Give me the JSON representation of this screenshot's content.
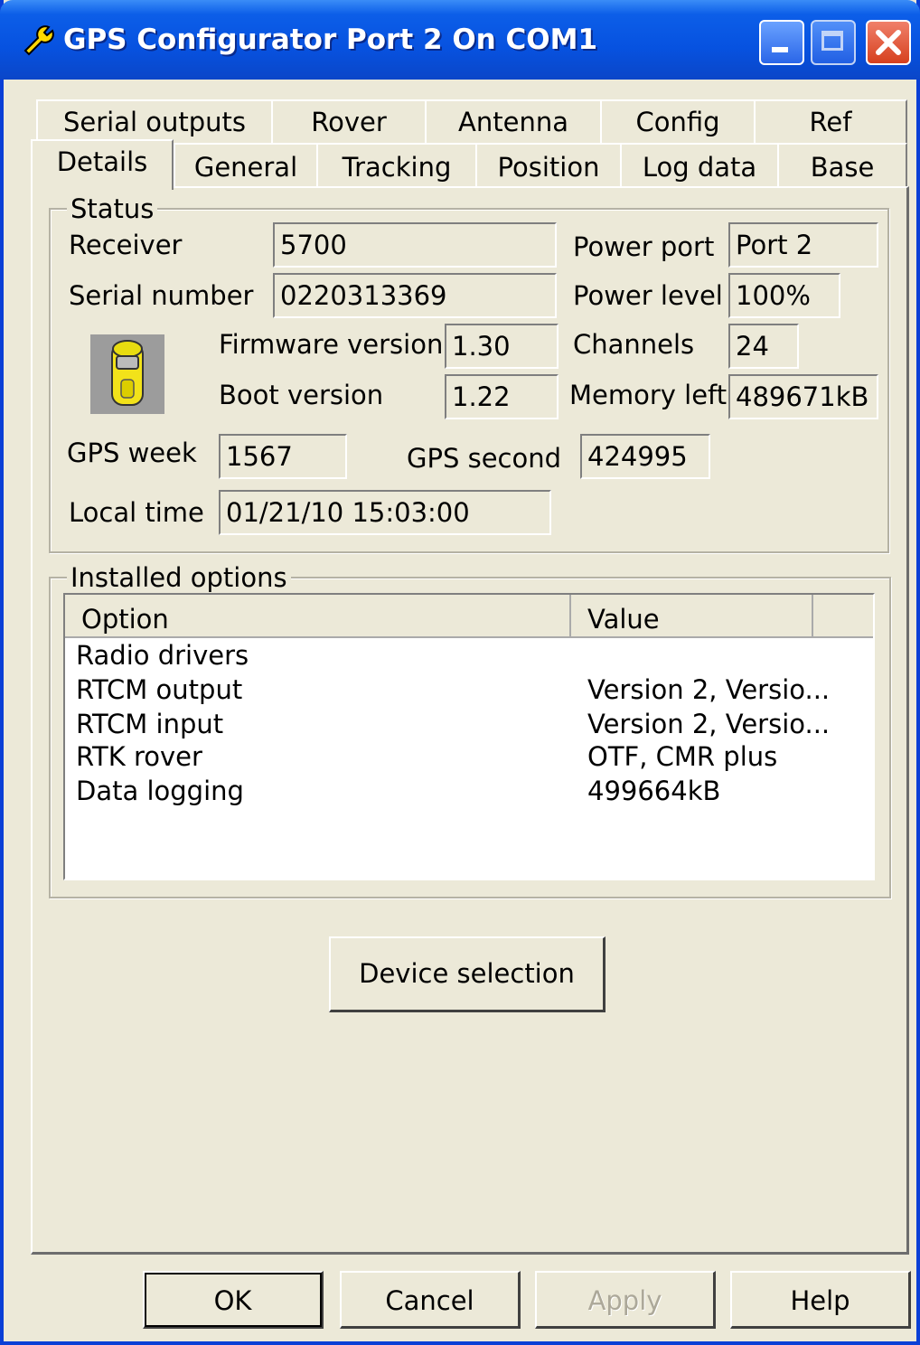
{
  "window": {
    "title": "GPS Configurator Port 2 On COM1",
    "controls": {
      "minimize": "minimize-icon",
      "maximize": "maximize-icon",
      "close": "close-icon"
    }
  },
  "tabs": {
    "back_row": [
      "Serial outputs",
      "Rover",
      "Antenna",
      "Config",
      "Ref"
    ],
    "front_row": [
      "Details",
      "General",
      "Tracking",
      "Position",
      "Log data",
      "Base"
    ],
    "selected": "Details"
  },
  "status": {
    "legend": "Status",
    "receiver_label": "Receiver",
    "receiver_value": "5700",
    "serial_label": "Serial number",
    "serial_value": "0220313369",
    "firmware_label": "Firmware version",
    "firmware_value": "1.30",
    "boot_label": "Boot version",
    "boot_value": "1.22",
    "gps_week_label": "GPS week",
    "gps_week_value": "1567",
    "gps_second_label": "GPS second",
    "gps_second_value": "424995",
    "local_time_label": "Local time",
    "local_time_value": "01/21/10 15:03:00",
    "power_port_label": "Power port",
    "power_port_value": "Port 2",
    "power_level_label": "Power level",
    "power_level_value": "100%",
    "channels_label": "Channels",
    "channels_value": "24",
    "memory_label": "Memory left",
    "memory_value": "489671kB",
    "device_icon": "gps-receiver-icon"
  },
  "options": {
    "legend": "Installed options",
    "columns": [
      "Option",
      "Value"
    ],
    "rows": [
      {
        "option": "Radio drivers",
        "value": ""
      },
      {
        "option": "RTCM output",
        "value": "Version 2, Versio..."
      },
      {
        "option": "RTCM input",
        "value": "Version 2, Versio..."
      },
      {
        "option": "RTK rover",
        "value": "OTF, CMR plus"
      },
      {
        "option": "Data logging",
        "value": "499664kB"
      }
    ]
  },
  "device_selection_label": "Device selection",
  "buttons": {
    "ok": "OK",
    "cancel": "Cancel",
    "apply": "Apply",
    "help": "Help"
  },
  "colors": {
    "titlebar": "#0752e0",
    "window_bg": "#ece9d8",
    "close_button": "#d6401e",
    "device_icon": "#f2e21a"
  }
}
